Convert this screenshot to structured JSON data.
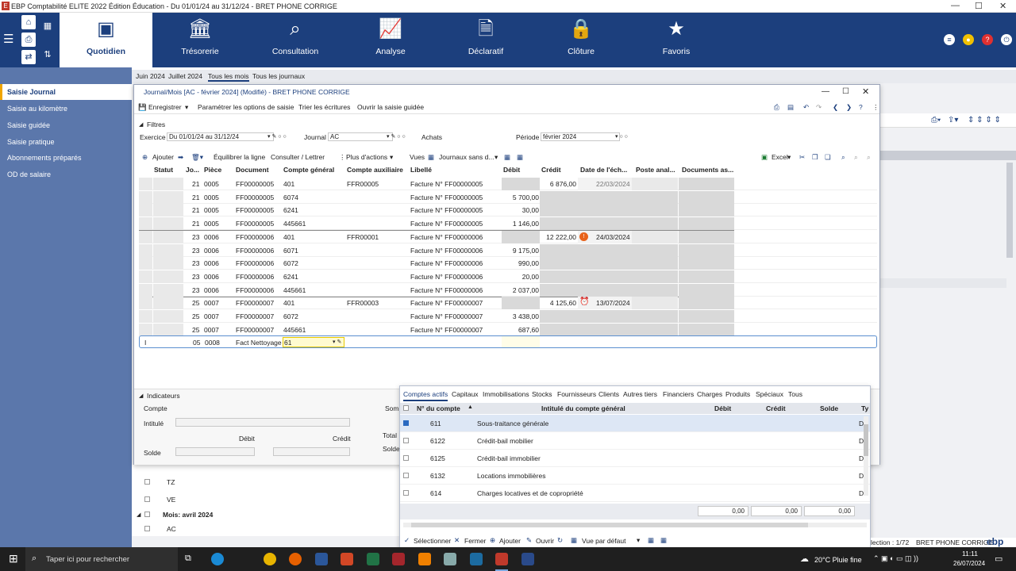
{
  "app": {
    "title": "EBP Comptabilité ELITE 2022 Édition Éducation - Du 01/01/24 au 31/12/24 - BRET PHONE CORRIGE"
  },
  "ribbon": {
    "tabs": [
      {
        "label": "Quotidien",
        "icon": "calendar-icon"
      },
      {
        "label": "Trésorerie",
        "icon": "bank-icon"
      },
      {
        "label": "Consultation",
        "icon": "search-doc-icon"
      },
      {
        "label": "Analyse",
        "icon": "chart-icon"
      },
      {
        "label": "Déclaratif",
        "icon": "tax-icon"
      },
      {
        "label": "Clôture",
        "icon": "lock-icon"
      },
      {
        "label": "Favoris",
        "icon": "star-icon"
      }
    ]
  },
  "sidebar": {
    "items": [
      {
        "label": "Saisie Journal"
      },
      {
        "label": "Saisie au kilomètre"
      },
      {
        "label": "Saisie guidée"
      },
      {
        "label": "Saisie pratique"
      },
      {
        "label": "Abonnements préparés"
      },
      {
        "label": "OD de salaire"
      }
    ],
    "bg_items": [
      "TZ",
      "VE",
      "Mois: avril 2024",
      "AC"
    ]
  },
  "period_tabs": [
    "Juin 2024",
    "Juillet 2024",
    "Tous les mois",
    "Tous les journaux"
  ],
  "window": {
    "title": "Journal/Mois [AC - février 2024] (Modifié) - BRET PHONE CORRIGE",
    "toolbar": {
      "save": "Enregistrer",
      "options": "Paramétrer les options de saisie",
      "sort": "Trier les écritures",
      "guided": "Ouvrir la saisie guidée"
    },
    "filters": {
      "label": "Filtres",
      "exercice_label": "Exercice",
      "exercice": "Du 01/01/24 au 31/12/24",
      "journal_label": "Journal",
      "journal": "AC",
      "journal_name": "Achats",
      "periode_label": "Période",
      "periode": "février 2024"
    },
    "grid_toolbar": {
      "add": "Ajouter",
      "balance": "Équilibrer la ligne",
      "consult": "Consulter / Lettrer",
      "more": "Plus d'actions",
      "views_label": "Vues",
      "view": "Journaux sans d...",
      "excel": "Excel"
    },
    "columns": [
      "Statut",
      "Jo...",
      "Pièce",
      "Document",
      "Compte général",
      "Compte auxiliaire",
      "Libellé",
      "Débit",
      "Crédit",
      "Date de l'éch...",
      "Poste anal...",
      "Documents as..."
    ],
    "rows": [
      {
        "jour": "21",
        "piece": "0005",
        "doc": "FF00000005",
        "compte": "401",
        "aux": "FFR00005",
        "lib": "Facture N° FF00000005",
        "debit": "",
        "credit": "6 876,00",
        "ech": "22/03/2024"
      },
      {
        "jour": "21",
        "piece": "0005",
        "doc": "FF00000005",
        "compte": "6074",
        "aux": "",
        "lib": "Facture N° FF00000005",
        "debit": "5 700,00",
        "credit": "",
        "ech": ""
      },
      {
        "jour": "21",
        "piece": "0005",
        "doc": "FF00000005",
        "compte": "6241",
        "aux": "",
        "lib": "Facture N° FF00000005",
        "debit": "30,00",
        "credit": "",
        "ech": ""
      },
      {
        "jour": "21",
        "piece": "0005",
        "doc": "FF00000005",
        "compte": "445661",
        "aux": "",
        "lib": "Facture N° FF00000005",
        "debit": "1 146,00",
        "credit": "",
        "ech": ""
      },
      {
        "jour": "23",
        "piece": "0006",
        "doc": "FF00000006",
        "compte": "401",
        "aux": "FFR00001",
        "lib": "Facture N° FF00000006",
        "debit": "",
        "credit": "12 222,00",
        "ech": "24/03/2024"
      },
      {
        "jour": "23",
        "piece": "0006",
        "doc": "FF00000006",
        "compte": "6071",
        "aux": "",
        "lib": "Facture N° FF00000006",
        "debit": "9 175,00",
        "credit": "",
        "ech": ""
      },
      {
        "jour": "23",
        "piece": "0006",
        "doc": "FF00000006",
        "compte": "6072",
        "aux": "",
        "lib": "Facture N° FF00000006",
        "debit": "990,00",
        "credit": "",
        "ech": ""
      },
      {
        "jour": "23",
        "piece": "0006",
        "doc": "FF00000006",
        "compte": "6241",
        "aux": "",
        "lib": "Facture N° FF00000006",
        "debit": "20,00",
        "credit": "",
        "ech": ""
      },
      {
        "jour": "23",
        "piece": "0006",
        "doc": "FF00000006",
        "compte": "445661",
        "aux": "",
        "lib": "Facture N° FF00000006",
        "debit": "2 037,00",
        "credit": "",
        "ech": ""
      },
      {
        "jour": "25",
        "piece": "0007",
        "doc": "FF00000007",
        "compte": "401",
        "aux": "FFR00003",
        "lib": "Facture N° FF00000007",
        "debit": "",
        "credit": "4 125,60",
        "ech": "13/07/2024"
      },
      {
        "jour": "25",
        "piece": "0007",
        "doc": "FF00000007",
        "compte": "6072",
        "aux": "",
        "lib": "Facture N° FF00000007",
        "debit": "3 438,00",
        "credit": "",
        "ech": ""
      },
      {
        "jour": "25",
        "piece": "0007",
        "doc": "FF00000007",
        "compte": "445661",
        "aux": "",
        "lib": "Facture N° FF00000007",
        "debit": "687,60",
        "credit": "",
        "ech": ""
      }
    ],
    "edit_row": {
      "marker": "I",
      "jour": "05",
      "piece": "0008",
      "doc": "Fact Nettoyage",
      "compte": "61"
    },
    "indicators": {
      "label": "Indicateurs",
      "compte": "Compte",
      "intitule": "Intitulé",
      "debit": "Débit",
      "credit": "Crédit",
      "solde": "Solde",
      "total": "Total",
      "solde2": "Solde",
      "som": "Som"
    }
  },
  "popup": {
    "tabs": [
      "Comptes actifs",
      "Capitaux",
      "Immobilisations",
      "Stocks",
      "Fournisseurs",
      "Clients",
      "Autres tiers",
      "Financiers",
      "Charges",
      "Produits",
      "Spéciaux",
      "Tous"
    ],
    "columns": [
      "N° du compte",
      "Intitulé du compte général",
      "Débit",
      "Crédit",
      "Solde",
      "Ty"
    ],
    "rows": [
      {
        "num": "611",
        "label": "Sous-traitance générale",
        "type": "D",
        "checked": true
      },
      {
        "num": "6122",
        "label": "Crédit-bail mobilier",
        "type": "D",
        "checked": false
      },
      {
        "num": "6125",
        "label": "Crédit-bail immobilier",
        "type": "D",
        "checked": false
      },
      {
        "num": "6132",
        "label": "Locations immobilières",
        "type": "D",
        "checked": false
      },
      {
        "num": "614",
        "label": "Charges locatives et de copropriété",
        "type": "D",
        "checked": false
      }
    ],
    "totals": [
      "0,00",
      "0,00",
      "0,00"
    ],
    "footer": {
      "select": "Sélectionner",
      "close": "Fermer",
      "add": "Ajouter",
      "open": "Ouvrir",
      "view": "Vue par défaut"
    }
  },
  "status": {
    "selection": "lection : 1/72",
    "company": "BRET PHONE CORRIGE",
    "brand": "ebp"
  },
  "taskbar": {
    "search": "Taper ici pour rechercher",
    "weather": "20°C  Pluie fine",
    "time": "11:11",
    "date": "26/07/2024"
  }
}
